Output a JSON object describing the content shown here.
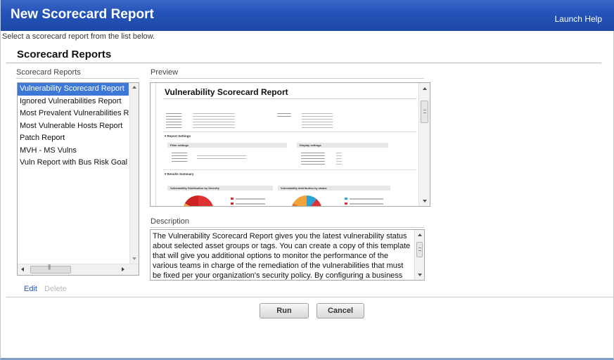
{
  "window": {
    "title": "New Scorecard Report",
    "help_link": "Launch Help"
  },
  "instructions": "Select a scorecard report from the list below.",
  "section_title": "Scorecard Reports",
  "report_list": {
    "header": "Scorecard Reports",
    "selected_index": 0,
    "items": [
      "Vulnerability Scorecard Report",
      "Ignored Vulnerabilities Report",
      "Most Prevalent Vulnerabilities Report",
      "Most Vulnerable Hosts Report",
      "Patch Report",
      "MVH - MS Vulns",
      "Vuln Report with Bus Risk Goal"
    ],
    "edit_label": "Edit",
    "delete_label": "Delete"
  },
  "preview": {
    "header": "Preview",
    "doc_title": "Vulnerability Scorecard Report",
    "sections": {
      "report_settings": "▾ Report Settings",
      "filter_settings": "Filter settings",
      "display_settings": "Display settings",
      "results_summary": "▾ Results Summary",
      "by_severity": "Vulnerability Distribution by Severity",
      "by_status": "Vulnerability distribution by status"
    }
  },
  "description": {
    "header": "Description",
    "text": "The Vulnerability Scorecard Report gives you the latest vulnerability status about selected asset groups or tags. You can create a copy of this template that will give you additional options to monitor the performance of the various teams in charge of the remediation of the vulnerabilities that must be fixed per your organization's security policy. By configuring a business risk goal you"
  },
  "buttons": {
    "run": "Run",
    "cancel": "Cancel"
  },
  "colors": {
    "titlebar": "#2454b9",
    "selection": "#3d78d8",
    "link": "#2255bb"
  }
}
